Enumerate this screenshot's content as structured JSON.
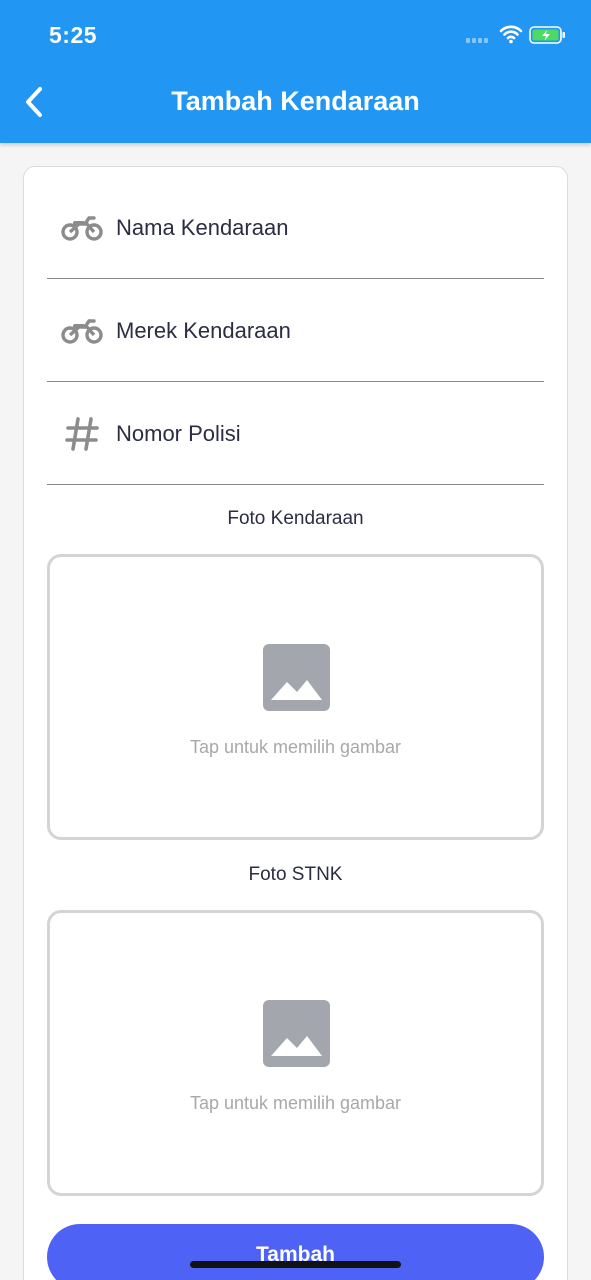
{
  "status_bar": {
    "time": "5:25",
    "signal_icon": "signal-dots-icon",
    "wifi_icon": "wifi-icon",
    "battery_icon": "battery-charging-icon",
    "battery_color": "#4cd964"
  },
  "app_bar": {
    "title": "Tambah Kendaraan",
    "back_icon": "chevron-left-icon",
    "background_color": "#2196f3"
  },
  "form": {
    "fields": [
      {
        "label": "Nama Kendaraan",
        "icon": "motorcycle-icon"
      },
      {
        "label": "Merek Kendaraan",
        "icon": "motorcycle-icon"
      },
      {
        "label": "Nomor Polisi",
        "icon": "hashtag-icon"
      }
    ],
    "photo_vehicle": {
      "label": "Foto Kendaraan",
      "hint": "Tap untuk memilih gambar",
      "icon": "image-placeholder-icon"
    },
    "photo_stnk": {
      "label": "Foto STNK",
      "hint": "Tap untuk memilih gambar",
      "icon": "image-placeholder-icon"
    },
    "submit_label": "Tambah",
    "submit_color": "#4e63f6"
  }
}
